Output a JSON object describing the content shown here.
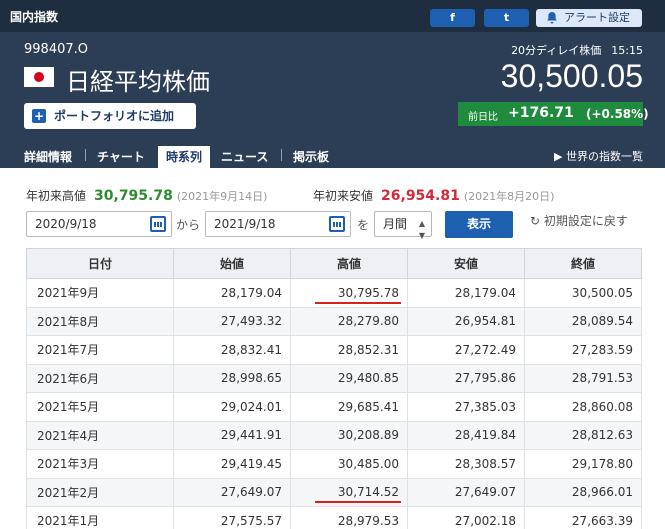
{
  "category": "国内指数",
  "share": {
    "facebook": "f",
    "twitter": "t"
  },
  "alert": "アラート設定",
  "code": "998407.O",
  "name": "日経平均株価",
  "delay_label": "20分ディレイ株価",
  "time": "15:15",
  "price": "30,500.05",
  "change": {
    "label": "前日比",
    "value": "+176.71",
    "pct": "(+0.58%)"
  },
  "portfolio_button": "ポートフォリオに追加",
  "tabs": [
    "詳細情報",
    "チャート",
    "時系列",
    "ニュース",
    "掲示板"
  ],
  "world_link": "世界の指数一覧",
  "ytd": {
    "high_label": "年初来高値",
    "high_value": "30,795.78",
    "high_date": "(2021年9月14日)",
    "low_label": "年初来安値",
    "low_value": "26,954.81",
    "low_date": "(2021年8月20日)"
  },
  "filter": {
    "from": "2020/9/18",
    "from_word": "から",
    "to": "2021/9/18",
    "to_word": "を",
    "period": "月間",
    "submit": "表示",
    "reset": "初期設定に戻す"
  },
  "table": {
    "headers": [
      "日付",
      "始値",
      "高値",
      "安値",
      "終値"
    ],
    "rows": [
      [
        "2021年9月",
        "28,179.04",
        "30,795.78",
        "28,179.04",
        "30,500.05"
      ],
      [
        "2021年8月",
        "27,493.32",
        "28,279.80",
        "26,954.81",
        "28,089.54"
      ],
      [
        "2021年7月",
        "28,832.41",
        "28,852.31",
        "27,272.49",
        "27,283.59"
      ],
      [
        "2021年6月",
        "28,998.65",
        "29,480.85",
        "27,795.86",
        "28,791.53"
      ],
      [
        "2021年5月",
        "29,024.01",
        "29,685.41",
        "27,385.03",
        "28,860.08"
      ],
      [
        "2021年4月",
        "29,441.91",
        "30,208.89",
        "28,419.84",
        "28,812.63"
      ],
      [
        "2021年3月",
        "29,419.45",
        "30,485.00",
        "28,308.57",
        "29,178.80"
      ],
      [
        "2021年2月",
        "27,649.07",
        "30,714.52",
        "27,649.07",
        "28,966.01"
      ],
      [
        "2021年1月",
        "27,575.57",
        "28,979.53",
        "27,002.18",
        "27,663.39"
      ]
    ]
  },
  "colors": {
    "header": "#2c3e55",
    "accent": "#1d5fb0",
    "up": "#1f8b3c",
    "high": "#2e8b2e",
    "low": "#d2283c",
    "underline": "#d8201c"
  }
}
